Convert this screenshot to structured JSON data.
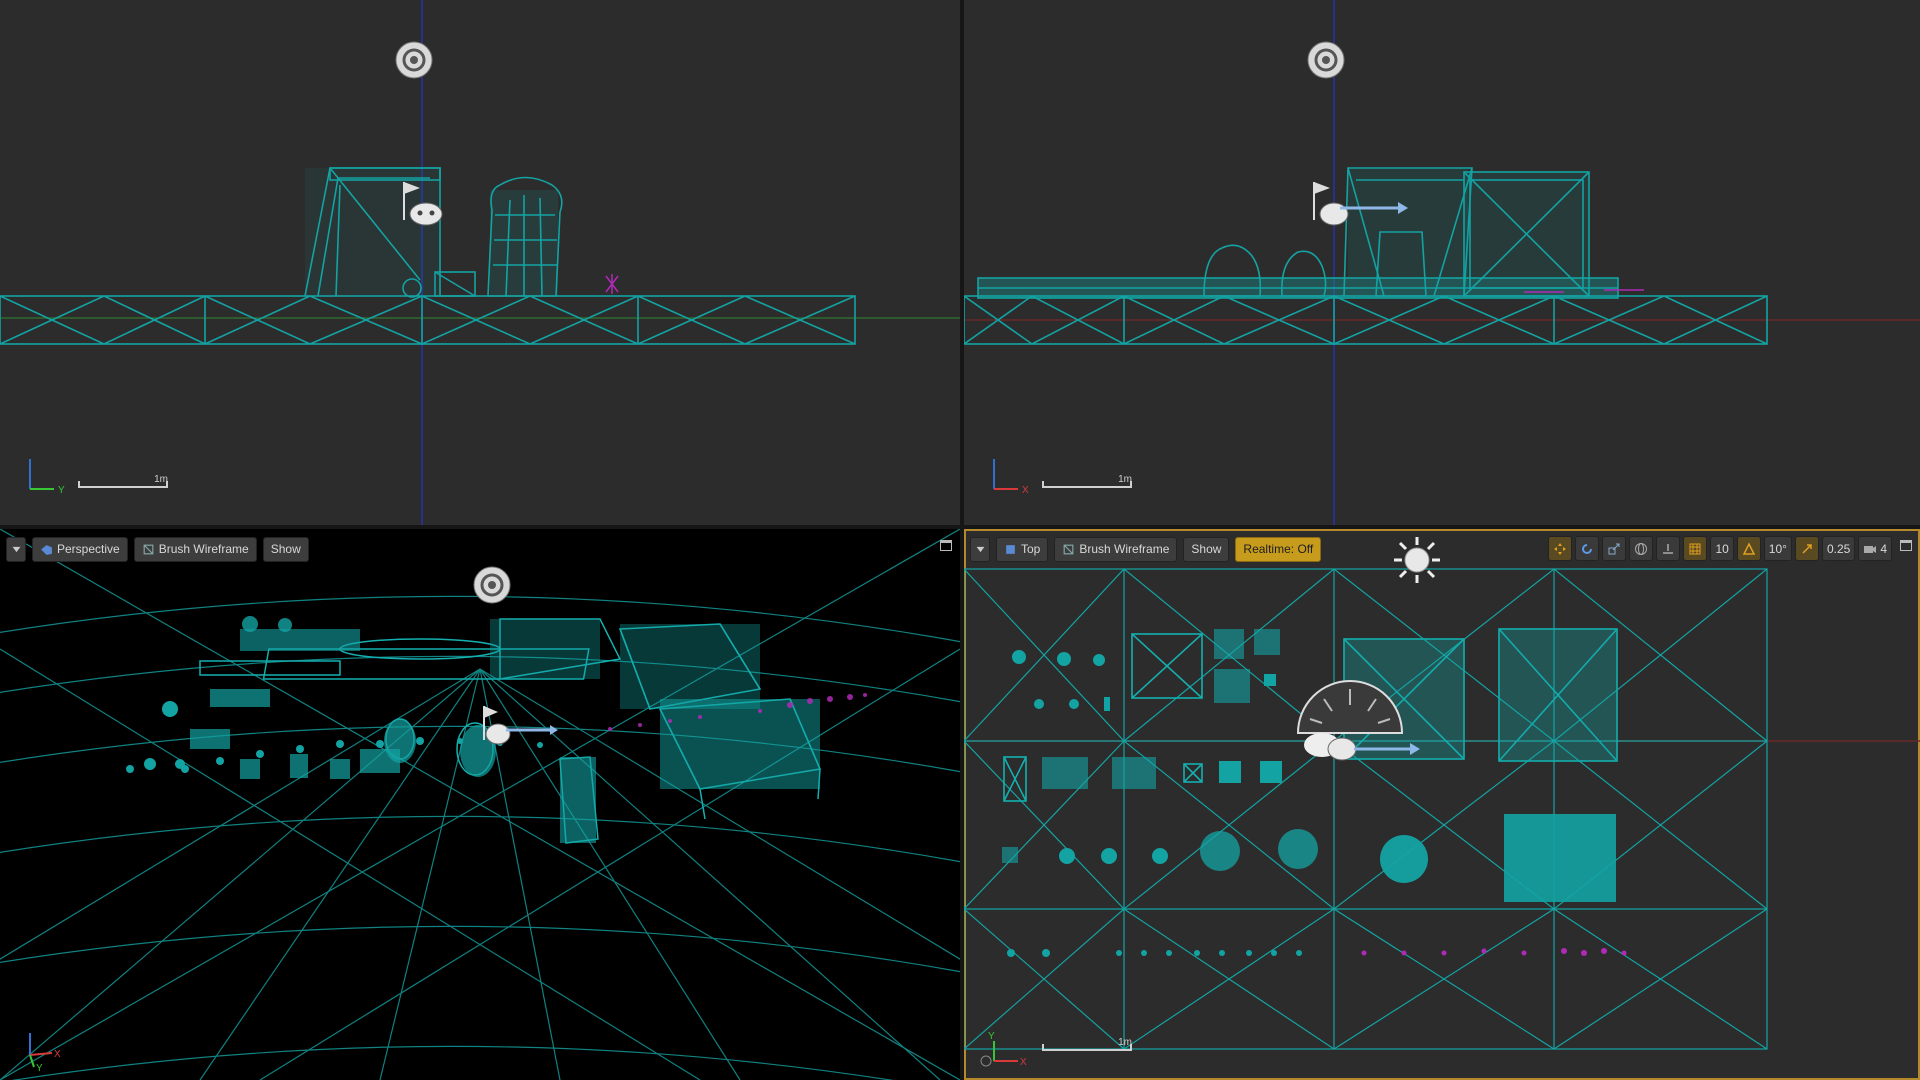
{
  "viewports": {
    "top_left": {
      "axis": {
        "up": "Z",
        "right": "Y"
      },
      "scale_label": "1m"
    },
    "top_right": {
      "axis": {
        "up": "Z",
        "right": "X"
      },
      "scale_label": "1m"
    },
    "bottom_left": {
      "view_mode_label": "Perspective",
      "render_mode_label": "Brush Wireframe",
      "show_label": "Show",
      "axis": {
        "right": "X",
        "forward": "Y"
      }
    },
    "bottom_right": {
      "view_mode_label": "Top",
      "render_mode_label": "Brush Wireframe",
      "show_label": "Show",
      "realtime_label": "Realtime: Off",
      "grid_snap_value": "10",
      "rotation_snap_value": "10°",
      "scale_snap_value": "0.25",
      "camera_speed_value": "4",
      "scale_label": "1m",
      "axis": {
        "up": "Y",
        "right": "X"
      }
    }
  },
  "colors": {
    "wireframe": "#14a3a3",
    "viewport_bg": "#2c2c2c",
    "perspective_bg": "#000000",
    "particles": "#b02ab8",
    "active_border": "#b58a2a",
    "realtime_btn": "#c79b1b"
  },
  "icons": [
    "sky-sphere-icon",
    "player-start-icon",
    "directional-light-icon",
    "skylight-icon"
  ]
}
